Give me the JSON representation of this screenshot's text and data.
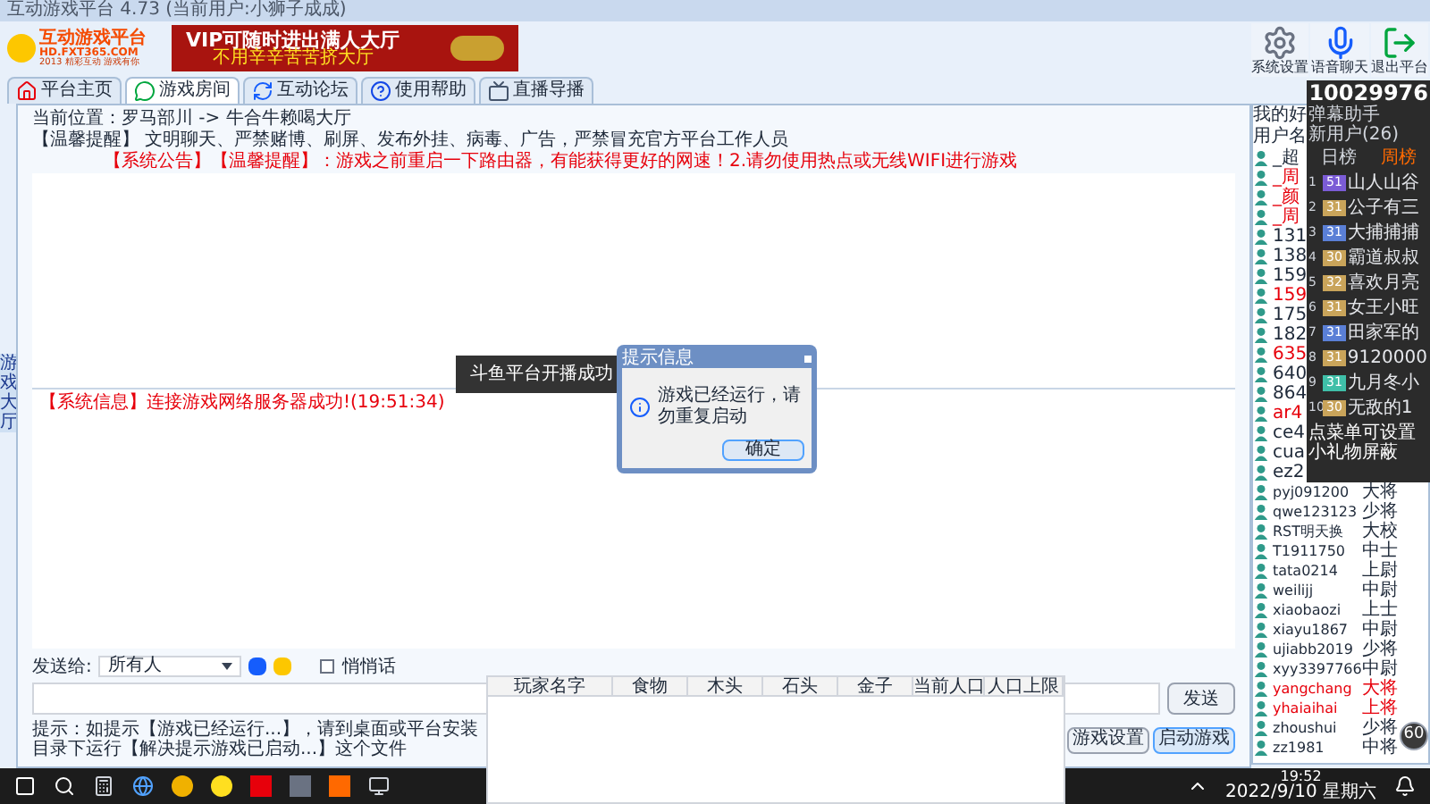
{
  "window": {
    "title": "互动游戏平台 4.73 (当前用户:小狮子成成)"
  },
  "header": {
    "logo_title": "互动游戏平台",
    "logo_url": "HD.FXT365.COM",
    "logo_slogan": "2013 精彩互动 游戏有你",
    "banner_title": "VIP可随时进出满人大厅",
    "banner_subtitle": "不用辛辛苦苦挤大厅"
  },
  "toolbar": [
    {
      "label": "系统设置",
      "kind": "gear"
    },
    {
      "label": "语音聊天",
      "kind": "mic"
    },
    {
      "label": "退出平台",
      "kind": "exit"
    }
  ],
  "tabs": [
    {
      "label": "平台主页",
      "selected": false,
      "kind": "home"
    },
    {
      "label": "游戏房间",
      "selected": true,
      "kind": "chat"
    },
    {
      "label": "互动论坛",
      "selected": false,
      "kind": "forum"
    },
    {
      "label": "使用帮助",
      "selected": false,
      "kind": "help"
    },
    {
      "label": "直播导播",
      "selected": false,
      "kind": "live"
    }
  ],
  "side_tab": "游戏大厅",
  "location": "当前位置：罗马部川 -> 牛合牛赖喝大厅",
  "tip": "【温馨提醒】 文明聊天、严禁赌博、刷屏、发布外挂、病毒、广告，严禁冒充官方平台工作人员",
  "announcement": "【系统公告】【温馨提醒】：游戏之前重启一下路由器，有能获得更好的网速！2.请勿使用热点或无线WIFI进行游戏",
  "toast": "斗鱼平台开播成功",
  "system_message": "【系统信息】连接游戏网络服务器成功!(19:51:34)",
  "send": {
    "label": "发送给:",
    "target": "所有人",
    "whisper_label": "悄悄话",
    "whisper": false,
    "button": "发送"
  },
  "hint": "提示：如提示【游戏已经运行...】，请到桌面或平台安装目录下运行【解决提示游戏已启动...】这个文件",
  "buttons": [
    "游戏设置",
    "启动游戏"
  ],
  "dialog": {
    "title": "提示信息",
    "message": "游戏已经运行，请勿重复启动",
    "button": "确定"
  },
  "stats_table": {
    "columns": [
      "玩家名字",
      "食物",
      "木头",
      "石头",
      "金子",
      "当前人口",
      "人口上限"
    ]
  },
  "users": {
    "tab": "我的好",
    "column": "用户名",
    "hidden_rows": [
      {
        "name": "_超",
        "red": false
      },
      {
        "name": "_周",
        "red": true
      },
      {
        "name": "_颜",
        "red": true
      },
      {
        "name": "_周",
        "red": true
      },
      {
        "name": "131",
        "red": false
      },
      {
        "name": "138",
        "red": false
      },
      {
        "name": "159",
        "red": false
      },
      {
        "name": "159",
        "red": true
      },
      {
        "name": "175",
        "red": false
      },
      {
        "name": "182",
        "red": false
      },
      {
        "name": "635",
        "red": true
      },
      {
        "name": "640",
        "red": false
      },
      {
        "name": "864",
        "red": false
      },
      {
        "name": "ar4",
        "red": true
      },
      {
        "name": "ce4",
        "red": false
      },
      {
        "name": "cua",
        "red": false
      },
      {
        "name": "ez2",
        "red": false
      }
    ],
    "rows": [
      {
        "name": "pyj091200",
        "rank": "大将",
        "red": false
      },
      {
        "name": "qwe123123",
        "rank": "少将",
        "red": false
      },
      {
        "name": "RST明天换",
        "rank": "大校",
        "red": false
      },
      {
        "name": "T1911750",
        "rank": "中士",
        "red": false
      },
      {
        "name": "tata0214",
        "rank": "上尉",
        "red": false
      },
      {
        "name": "weilijj",
        "rank": "中尉",
        "red": false
      },
      {
        "name": "xiaobaozi",
        "rank": "上士",
        "red": false
      },
      {
        "name": "xiayu1867",
        "rank": "中尉",
        "red": false
      },
      {
        "name": "ujiabb2019",
        "rank": "少将",
        "red": false
      },
      {
        "name": "xyy3397766",
        "rank": "中尉",
        "red": false
      },
      {
        "name": "yangchang",
        "rank": "大将",
        "red": true
      },
      {
        "name": "yhaiaihai",
        "rank": "上将",
        "red": true
      },
      {
        "name": "zhoushui",
        "rank": "少将",
        "red": false
      },
      {
        "name": "zz1981",
        "rank": "中将",
        "red": false
      }
    ]
  },
  "stream": {
    "room_id": "10029976",
    "assistant": "弹幕助手",
    "users_label": "新用户(26)",
    "tab_left": "日榜",
    "tab_right": "周榜",
    "notice": "点菜单可设置小礼物屏蔽",
    "ranking": [
      {
        "rank": "1",
        "level": "51",
        "name": "山人山谷",
        "color": "#7b5cd6"
      },
      {
        "rank": "2",
        "level": "31",
        "name": "公子有三",
        "color": "#c9a45a"
      },
      {
        "rank": "3",
        "level": "31",
        "name": "大捕捕捕",
        "color": "#5a7fd6"
      },
      {
        "rank": "4",
        "level": "30",
        "name": "霸道叔叔",
        "color": "#c9a45a"
      },
      {
        "rank": "5",
        "level": "32",
        "name": "喜欢月亮",
        "color": "#c9a45a"
      },
      {
        "rank": "6",
        "level": "31",
        "name": "女王小旺",
        "color": "#c9a45a"
      },
      {
        "rank": "7",
        "level": "31",
        "name": "田家军的",
        "color": "#5a7fd6"
      },
      {
        "rank": "8",
        "level": "31",
        "name": "9120000",
        "color": "#c9a45a"
      },
      {
        "rank": "9",
        "level": "31",
        "name": "九月冬小",
        "color": "#3fbfa8"
      },
      {
        "rank": "10",
        "level": "30",
        "name": "无敌的1",
        "color": "#c9a45a"
      }
    ]
  },
  "fps": "60",
  "taskbar": {
    "time": "19:52",
    "date": "2022/9/10 星期六"
  }
}
